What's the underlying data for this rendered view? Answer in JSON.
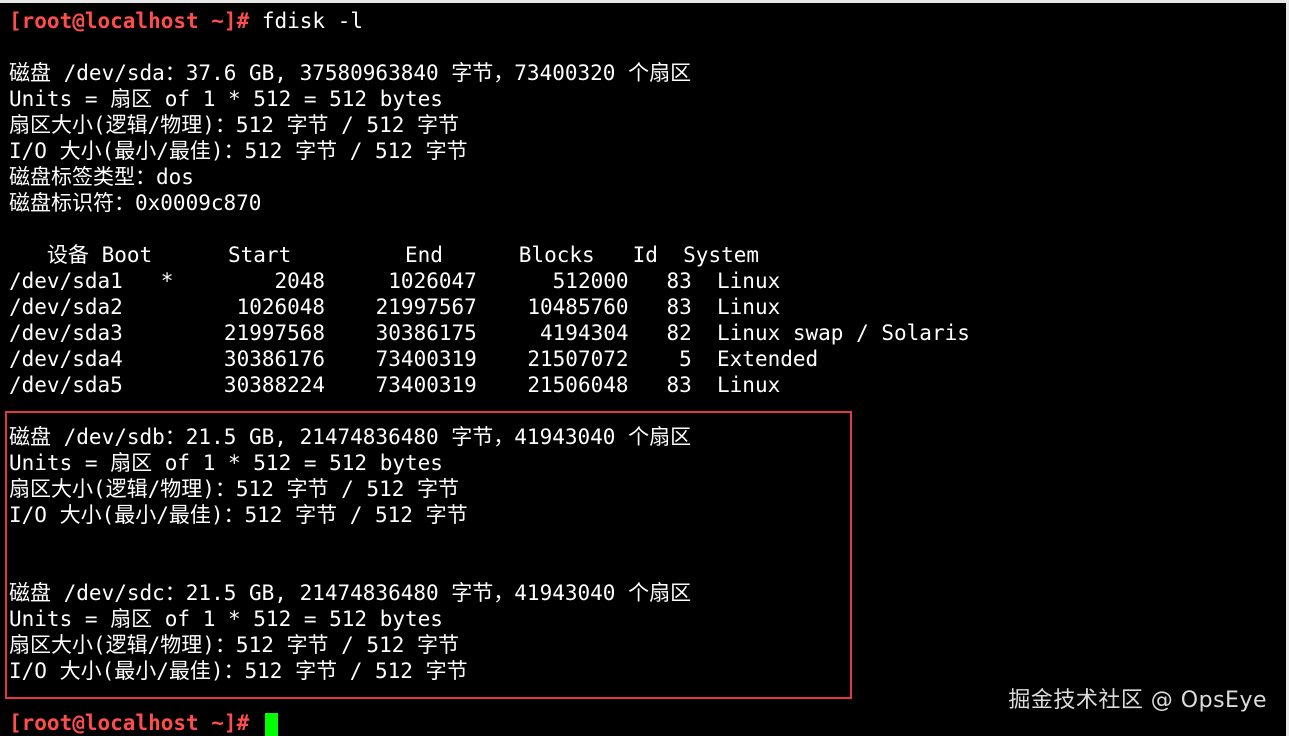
{
  "prompt": "[root@localhost ~]#",
  "command": " fdisk -l",
  "sda": {
    "header": "磁盘 /dev/sda：37.6 GB, 37580963840 字节，73400320 个扇区",
    "units": "Units = 扇区 of 1 * 512 = 512 bytes",
    "sector_size": "扇区大小(逻辑/物理)：512 字节 / 512 字节",
    "io_size": "I/O 大小(最小/最佳)：512 字节 / 512 字节",
    "label_type": "磁盘标签类型：dos",
    "identifier": "磁盘标识符：0x0009c870"
  },
  "partition_table": {
    "header": "   设备 Boot      Start         End      Blocks   Id  System",
    "rows": [
      "/dev/sda1   *        2048     1026047      512000   83  Linux",
      "/dev/sda2         1026048    21997567    10485760   83  Linux",
      "/dev/sda3        21997568    30386175     4194304   82  Linux swap / Solaris",
      "/dev/sda4        30386176    73400319    21507072    5  Extended",
      "/dev/sda5        30388224    73400319    21506048   83  Linux"
    ]
  },
  "sdb": {
    "header": "磁盘 /dev/sdb：21.5 GB, 21474836480 字节，41943040 个扇区",
    "units": "Units = 扇区 of 1 * 512 = 512 bytes",
    "sector_size": "扇区大小(逻辑/物理)：512 字节 / 512 字节",
    "io_size": "I/O 大小(最小/最佳)：512 字节 / 512 字节"
  },
  "sdc": {
    "header": "磁盘 /dev/sdc：21.5 GB, 21474836480 字节，41943040 个扇区",
    "units": "Units = 扇区 of 1 * 512 = 512 bytes",
    "sector_size": "扇区大小(逻辑/物理)：512 字节 / 512 字节",
    "io_size": "I/O 大小(最小/最佳)：512 字节 / 512 字节"
  },
  "final_prompt": "[root@localhost ~]#",
  "watermark": "掘金技术社区 @ OpsEye",
  "colors": {
    "background": "#000000",
    "text": "#ffffff",
    "prompt": "#ff4d4d",
    "cursor": "#00ff00",
    "highlight_border": "#e0383e"
  }
}
